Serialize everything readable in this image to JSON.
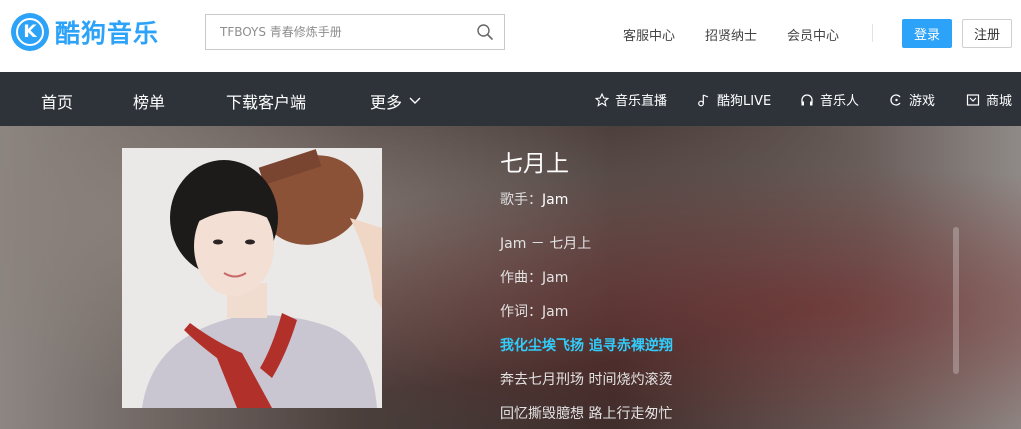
{
  "logo": {
    "k": "K",
    "text": "酷狗音乐"
  },
  "search": {
    "placeholder": "TFBOYS 青春修炼手册"
  },
  "top_links": [
    "客服中心",
    "招贤纳士",
    "会员中心"
  ],
  "auth": {
    "login": "登录",
    "register": "注册"
  },
  "nav": {
    "left": [
      "首页",
      "榜单",
      "下载客户端",
      "更多"
    ],
    "right": [
      {
        "label": "音乐直播",
        "icon": "star-icon"
      },
      {
        "label": "酷狗LIVE",
        "icon": "music-note-icon"
      },
      {
        "label": "音乐人",
        "icon": "headphones-icon"
      },
      {
        "label": "游戏",
        "icon": "game-icon"
      },
      {
        "label": "商城",
        "icon": "shop-icon"
      }
    ]
  },
  "song": {
    "title": "七月上",
    "artist_label": "歌手：",
    "artist": "Jam"
  },
  "lyrics": [
    "Jam － 七月上",
    "作曲：Jam",
    "作词：Jam",
    "我化尘埃飞扬 追寻赤裸逆翔",
    "奔去七月刑场 时间烧灼滚烫",
    "回忆撕毁臆想 路上行走匆忙"
  ],
  "active_lyric_index": 3,
  "colors": {
    "accent": "#2ca2f9",
    "nav_bg": "#2e333a",
    "active_lyric": "#31cdfc"
  }
}
